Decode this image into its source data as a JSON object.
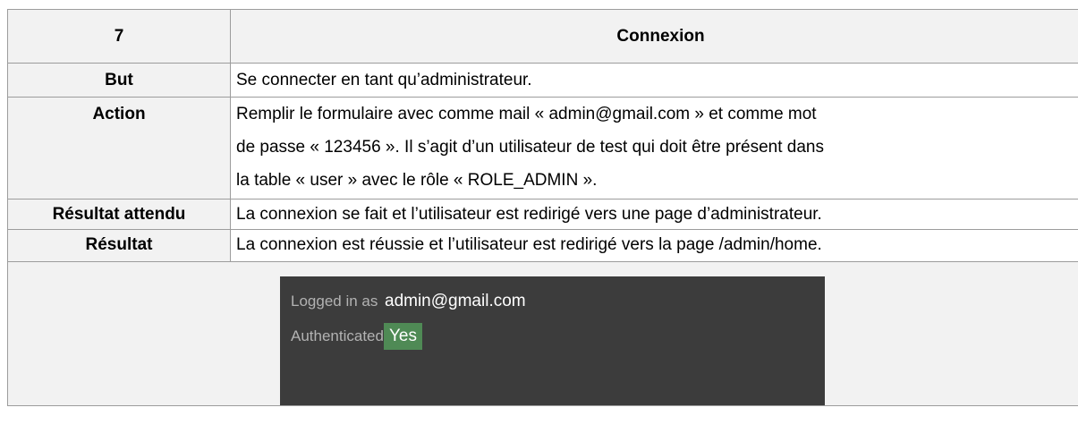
{
  "table": {
    "header": {
      "number": "7",
      "title": "Connexion"
    },
    "rows": [
      {
        "label": "But",
        "value": "Se connecter en tant qu’administrateur."
      },
      {
        "label": "Action",
        "lines": [
          "Remplir le formulaire avec comme mail « admin@gmail.com » et comme mot",
          "de passe « 123456 ». Il s’agit d’un utilisateur de test qui doit être présent dans",
          "la table « user » avec le rôle « ROLE_ADMIN »."
        ]
      },
      {
        "label": "Résultat attendu",
        "value": "La connexion se fait et l’utilisateur est redirigé vers une page d’administrateur."
      },
      {
        "label": "Résultat",
        "value": "La connexion est réussie et l’utilisateur est redirigé vers la page /admin/home."
      }
    ]
  },
  "screenshot": {
    "logged_in_label": "Logged in as",
    "logged_in_value": "admin@gmail.com",
    "authenticated_label": "Authenticated",
    "authenticated_value": "Yes",
    "badge_color": "#4f8a55",
    "panel_color": "#3c3c3c"
  }
}
